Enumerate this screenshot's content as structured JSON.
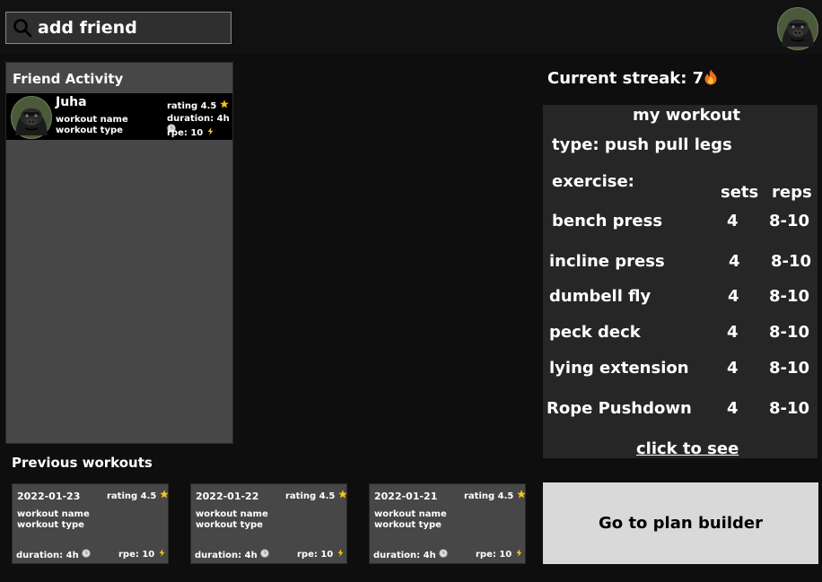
{
  "search": {
    "placeholder": "add friend"
  },
  "friend_activity": {
    "title": "Friend Activity",
    "items": [
      {
        "name": "Juha",
        "workout_name": "workout name",
        "workout_type": "workout type",
        "rating": "rating 4.5",
        "duration": "duration: 4h",
        "rpe": "rpe: 10"
      }
    ]
  },
  "streak": {
    "label": "Current streak: 7"
  },
  "my_workout": {
    "title": "my workout",
    "type": "type: push pull legs",
    "exercise_label": "exercise:",
    "sets_header": "sets",
    "reps_header": "reps",
    "exercises": [
      {
        "name": "bench press",
        "sets": "4",
        "reps": "8-10"
      },
      {
        "name": "incline  press",
        "sets": "4",
        "reps": "8-10"
      },
      {
        "name": "dumbell fly",
        "sets": "4",
        "reps": "8-10"
      },
      {
        "name": "peck deck",
        "sets": "4",
        "reps": "8-10"
      },
      {
        "name": "lying extension",
        "sets": "4",
        "reps": "8-10"
      },
      {
        "name": "Rope Pushdown",
        "sets": "4",
        "reps": "8-10"
      }
    ],
    "link": "click to see"
  },
  "previous_workouts": {
    "title": "Previous workouts",
    "items": [
      {
        "date": "2022-01-23",
        "rating": "rating 4.5",
        "workout_name": "workout name",
        "workout_type": "workout type",
        "duration": "duration: 4h",
        "rpe": "rpe: 10"
      },
      {
        "date": "2022-01-22",
        "rating": "rating 4.5",
        "workout_name": "workout name",
        "workout_type": "workout type",
        "duration": "duration: 4h",
        "rpe": "rpe: 10"
      },
      {
        "date": "2022-01-21",
        "rating": "rating 4.5",
        "workout_name": "workout name",
        "workout_type": "workout type",
        "duration": "duration: 4h",
        "rpe": "rpe: 10"
      }
    ]
  },
  "plan_builder": {
    "label": "Go to plan builder"
  },
  "icons": {
    "search": "search-icon",
    "rating": "star-icon",
    "duration": "clock-icon",
    "rpe": "lightning-icon",
    "streak": "fire-icon",
    "avatar": "gorilla-avatar"
  },
  "colors": {
    "background": "#0e0e0e",
    "panel": "#474747",
    "workout_panel": "#262626",
    "card": "#000000",
    "button": "#d9d9d9",
    "star": "#f5c518"
  }
}
